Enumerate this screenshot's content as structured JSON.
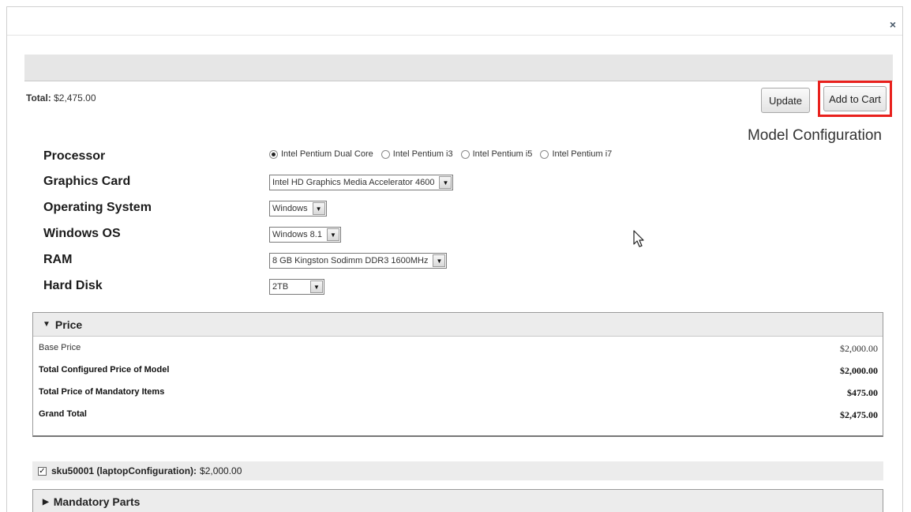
{
  "modal": {
    "close_glyph": "×"
  },
  "summary": {
    "total_label": "Total:",
    "total_value": "$2,475.00"
  },
  "actions": {
    "update_label": "Update",
    "add_to_cart_label": "Add to Cart"
  },
  "section_title": "Model Configuration",
  "config": {
    "processor": {
      "label": "Processor",
      "options": [
        "Intel Pentium Dual Core",
        "Intel Pentium i3",
        "Intel Pentium i5",
        "Intel Pentium i7"
      ],
      "selected": "Intel Pentium Dual Core"
    },
    "graphics": {
      "label": "Graphics Card",
      "value": "Intel HD Graphics Media Accelerator 4600"
    },
    "os": {
      "label": "Operating System",
      "value": "Windows"
    },
    "windows_os": {
      "label": "Windows OS",
      "value": "Windows 8.1"
    },
    "ram": {
      "label": "RAM",
      "value": "8 GB Kingston Sodimm DDR3 1600MHz"
    },
    "hard_disk": {
      "label": "Hard Disk",
      "value": "2TB"
    }
  },
  "price": {
    "header": "Price",
    "rows": [
      {
        "label": "Base Price",
        "value": "$2,000.00"
      },
      {
        "label": "Total Configured Price of Model",
        "value": "$2,000.00"
      },
      {
        "label": "Total Price of Mandatory Items",
        "value": "$475.00"
      },
      {
        "label": "Grand Total",
        "value": "$2,475.00"
      }
    ]
  },
  "sku": {
    "name": "sku50001 (laptopConfiguration):",
    "price": "$2,000.00",
    "checked": true
  },
  "mandatory_parts": {
    "header": "Mandatory Parts"
  },
  "colors": {
    "highlight": "#e8201c",
    "panel_header": "#ececec"
  }
}
